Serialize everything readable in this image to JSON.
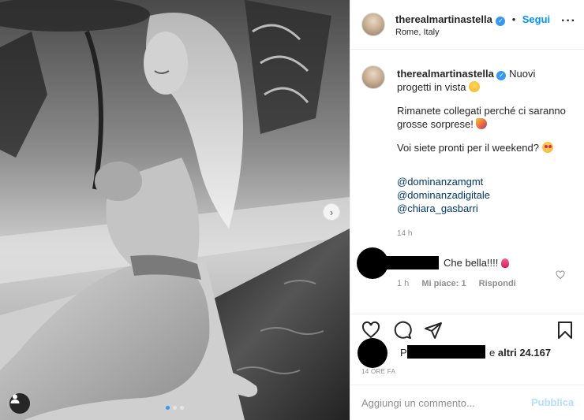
{
  "post": {
    "username": "therealmartinastella",
    "verified_icon": "verified-badge-icon",
    "follow_label": "Segui",
    "separator": "•",
    "location": "Rome, Italy",
    "more_icon": "more-options-icon",
    "carousel": {
      "current_slide": 1,
      "total_slides": 3
    }
  },
  "caption": {
    "username": "therealmartinastella",
    "line1": "Nuovi progetti in vista",
    "line2": "Rimanete collegati perché ci saranno grosse sorprese!",
    "line3": "Voi siete pronti per il weekend?",
    "mentions": [
      "@dominanzamgmt",
      "@dominanzadigitale",
      "@chiara_gasbarri"
    ],
    "time_ago": "14 h"
  },
  "comment": {
    "text": "Che bella!!!!",
    "time": "1 h",
    "likes": "Mi piace: 1",
    "reply": "Rispondi"
  },
  "actions": {
    "likes_prefix": "Piace",
    "likes_others": "e",
    "likes_count": "altri 24.167",
    "post_time": "14 ORE FA"
  },
  "add_comment": {
    "placeholder": "Aggiungi un commento...",
    "publish": "Pubblica"
  },
  "colors": {
    "accent": "#0095f6",
    "verified": "#3897f0",
    "mention": "#00376b",
    "muted": "#8e8e8e",
    "publish_disabled": "#b2dffc"
  }
}
